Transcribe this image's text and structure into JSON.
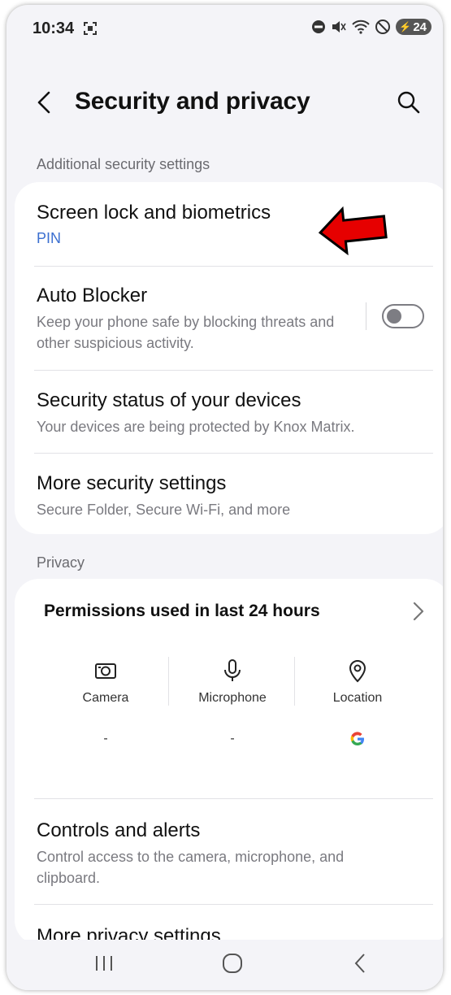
{
  "status_bar": {
    "time": "10:34",
    "battery": "24"
  },
  "header": {
    "title": "Security and privacy"
  },
  "sections": {
    "additional_security": "Additional security settings",
    "privacy": "Privacy"
  },
  "security_items": {
    "screen_lock": {
      "title": "Screen lock and biometrics",
      "subtitle": "PIN"
    },
    "auto_blocker": {
      "title": "Auto Blocker",
      "subtitle": "Keep your phone safe by blocking threats and other suspicious activity.",
      "enabled": false
    },
    "security_status": {
      "title": "Security status of your devices",
      "subtitle": "Your devices are being protected by Knox Matrix."
    },
    "more_security": {
      "title": "More security settings",
      "subtitle": "Secure Folder, Secure Wi-Fi, and more"
    }
  },
  "permissions": {
    "header": "Permissions used in last 24 hours",
    "items": [
      {
        "label": "Camera",
        "value": "-",
        "icon": "camera-icon"
      },
      {
        "label": "Microphone",
        "value": "-",
        "icon": "microphone-icon"
      },
      {
        "label": "Location",
        "value": "",
        "icon": "location-icon",
        "app_icon": "google-icon"
      }
    ]
  },
  "privacy_items": {
    "controls": {
      "title": "Controls and alerts",
      "subtitle": "Control access to the camera, microphone, and clipboard."
    },
    "more_privacy": {
      "title": "More privacy settings"
    }
  },
  "colors": {
    "accent_blue": "#3b6fd0",
    "annotation_red": "#e60000",
    "background": "#f4f4f8",
    "card": "#ffffff"
  }
}
